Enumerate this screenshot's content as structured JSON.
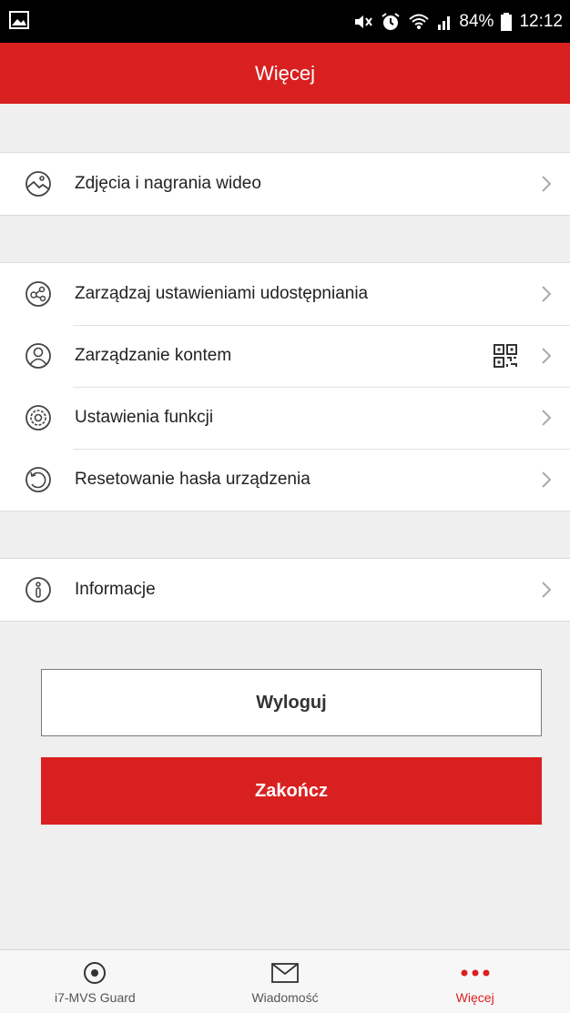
{
  "status_bar": {
    "battery": "84%",
    "time": "12:12"
  },
  "header": {
    "title": "Więcej"
  },
  "menu": {
    "group1": [
      {
        "label": "Zdjęcia i nagrania wideo",
        "icon": "photo-video-icon"
      }
    ],
    "group2": [
      {
        "label": "Zarządzaj ustawieniami udostępniania",
        "icon": "share-icon"
      },
      {
        "label": "Zarządzanie kontem",
        "icon": "account-icon",
        "extra_icon": "qr-code-icon"
      },
      {
        "label": "Ustawienia funkcji",
        "icon": "settings-icon"
      },
      {
        "label": "Resetowanie hasła urządzenia",
        "icon": "reset-icon"
      }
    ],
    "group3": [
      {
        "label": "Informacje",
        "icon": "info-icon"
      }
    ]
  },
  "buttons": {
    "logout": "Wyloguj",
    "exit": "Zakończ"
  },
  "tabs": [
    {
      "label": "i7-MVS Guard",
      "icon": "guard-icon",
      "active": false
    },
    {
      "label": "Wiadomość",
      "icon": "envelope-icon",
      "active": false
    },
    {
      "label": "Więcej",
      "icon": "more-dots-icon",
      "active": true
    }
  ],
  "colors": {
    "accent": "#d92020",
    "background": "#efeff0",
    "status_bar": "#000000"
  }
}
